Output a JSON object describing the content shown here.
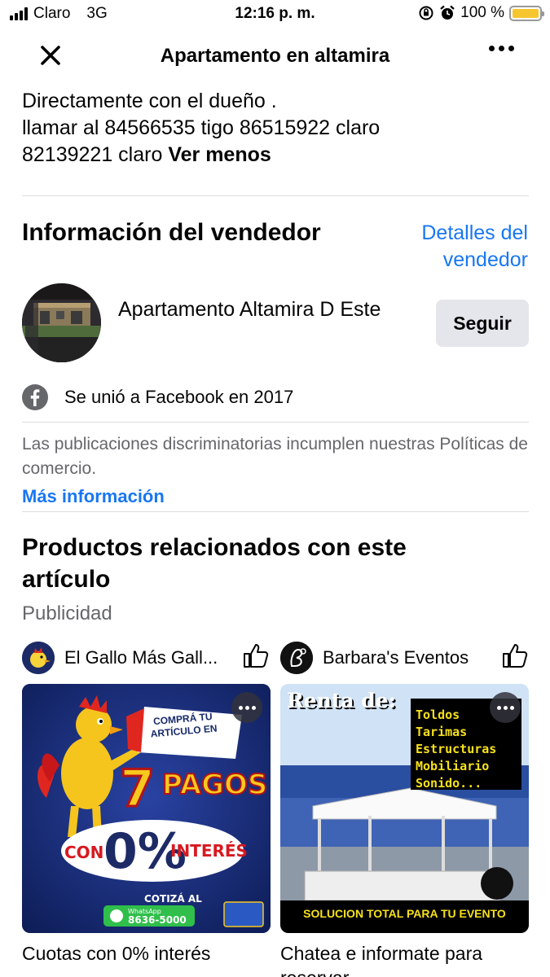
{
  "status_bar": {
    "carrier": "Claro",
    "network": "3G",
    "time": "12:16 p. m.",
    "battery": "100 %",
    "battery_level": 1.0
  },
  "header": {
    "title": "Apartamento en altamira",
    "close_icon": "close-icon",
    "more_icon": "more-icon"
  },
  "description": {
    "clipped_line": ". . . .",
    "line1": "Directamente con el dueño .",
    "line2": "llamar al 84566535 tigo  86515922 claro",
    "line3": "82139221 claro",
    "toggle": "Ver menos"
  },
  "seller": {
    "section_title": "Información del vendedor",
    "details_link": "Detalles del vendedor",
    "name": "Apartamento Altamira D Este",
    "follow_label": "Seguir",
    "joined": "Se unió a Facebook en 2017"
  },
  "policy": {
    "notice": "Las publicaciones discriminatorias incumplen nuestras Políticas de comercio.",
    "more_info": "Más información"
  },
  "related": {
    "title": "Productos relacionados con este artículo",
    "sponsored": "Publicidad",
    "ads": [
      {
        "advertiser": "El Gallo Más Gall...",
        "caption": "Cuotas con 0% interés",
        "image_text": {
          "badge": "COMPRÁ TU ARTÍCULO EN",
          "big": "7",
          "big_word": "PAGOS",
          "con": "CON",
          "percent": "0%",
          "interes": "INTERÉS",
          "cotiza": "COTIZÁ AL",
          "wa_label": "WhatsApp",
          "wa_number": "8636-5000",
          "logo": "El Gallo más Gallo"
        }
      },
      {
        "advertiser": "Barbara's Eventos",
        "caption": "Chatea e informate  para reservar",
        "image_text": {
          "heading": "Renta de:",
          "items": [
            "Toldos",
            "Tarimas",
            "Estructuras",
            "Mobiliario",
            "Sonido..."
          ],
          "banner": "SOLUCION TOTAL PARA TU EVENTO"
        }
      }
    ]
  },
  "colors": {
    "link": "#1877f2",
    "muted": "#65676b",
    "divider": "#dadde1",
    "button_bg": "#e4e6eb",
    "battery": "#f7c62f"
  }
}
